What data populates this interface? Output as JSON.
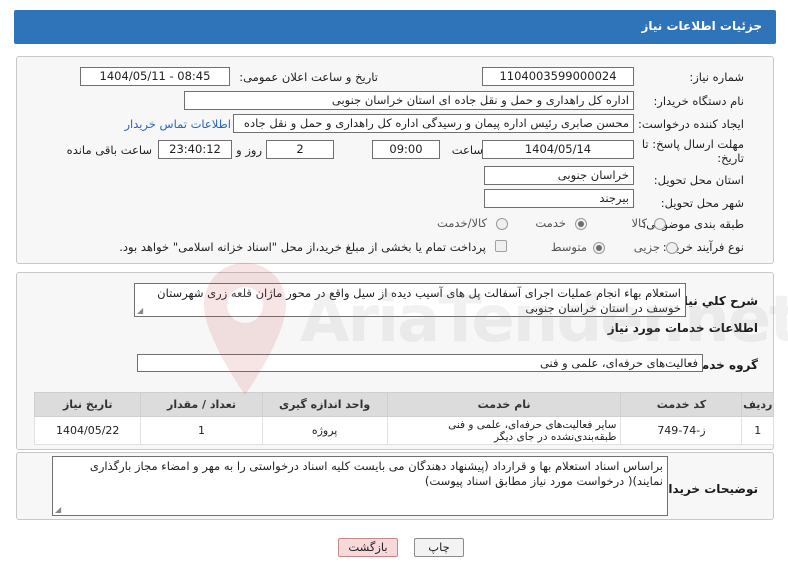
{
  "header": {
    "title": "جزئیات اطلاعات نیاز"
  },
  "need_info": {
    "need_number_label": "شماره نیاز:",
    "need_number": "1104003599000024",
    "announce_label": "تاریخ و ساعت اعلان عمومی:",
    "announce_value": "1404/05/11 - 08:45",
    "buyer_org_label": "نام دستگاه خریدار:",
    "buyer_org": "اداره کل راهداری و حمل و نقل جاده ای استان خراسان جنوبی",
    "creator_label": "ایجاد کننده درخواست:",
    "creator": "محسن صابری رئیس اداره پیمان و رسیدگی اداره کل راهداری و حمل و نقل جاده",
    "contact_link": "اطلاعات تماس خریدار",
    "deadline_label_1": "مهلت ارسال پاسخ: تا",
    "deadline_label_2": "تاریخ:",
    "deadline_date": "1404/05/14",
    "time_label": "ساعت",
    "deadline_time": "09:00",
    "days_value": "2",
    "days_label": "روز و",
    "remaining_time": "23:40:12",
    "remaining_label": "ساعت باقی مانده",
    "province_label": "استان محل تحویل:",
    "province": "خراسان جنوبی",
    "city_label": "شهر محل تحویل:",
    "city": "بیرجند",
    "category_label": "طبقه بندی موضوعی:",
    "category_options": [
      "کالا",
      "خدمت",
      "کالا/خدمت"
    ],
    "process_label": "نوع فرآیند خرید :",
    "process_options": [
      "جزیی",
      "متوسط"
    ],
    "payment_note": "پرداخت تمام یا بخشی از مبلغ خرید،از محل \"اسناد خزانه اسلامی\" خواهد بود."
  },
  "description": {
    "label": "شرح کلي نياز:",
    "text": "استعلام بهاء انجام عملیات اجرای آسفالت پل های آسیب دیده از سیل واقع در محور ماژان قلعه زری شهرستان خوسف در   استان خراسان جنوبی"
  },
  "services": {
    "section_title": "اطلاعات خدمات مورد نیاز",
    "group_label": "گروه خدمت:",
    "group_value": "فعالیت‌های حرفه‌ای، علمی و فنی",
    "columns": [
      "ردیف",
      "کد خدمت",
      "نام خدمت",
      "واحد اندازه گیری",
      "تعداد / مقدار",
      "تاریخ نیاز"
    ],
    "rows": [
      {
        "row": "1",
        "code": "ز-74-749",
        "name": "سایر فعالیت‌های حرفه‌ای، علمی و فنی طبقه‌بندی‌نشده در جای دیگر",
        "unit": "پروژه",
        "qty": "1",
        "date": "1404/05/22"
      }
    ]
  },
  "buyer_notes": {
    "label": "توضیحات خریدار:",
    "text": "براساس اسناد استعلام بها و قرارداد (پیشنهاد دهندگان می بایست کلیه اسناد درخواستی را به مهر و امضاء مجاز بارگذاری نمایند)( درخواست مورد نیاز مطابق اسناد پیوست)"
  },
  "actions": {
    "print_label": "چاپ",
    "back_label": "بازگشت"
  },
  "watermark": {
    "text": "AriaTender.net"
  },
  "colors": {
    "header": "#2f73b9",
    "link": "#2a67b5",
    "back_button": "#f8d9d9"
  }
}
